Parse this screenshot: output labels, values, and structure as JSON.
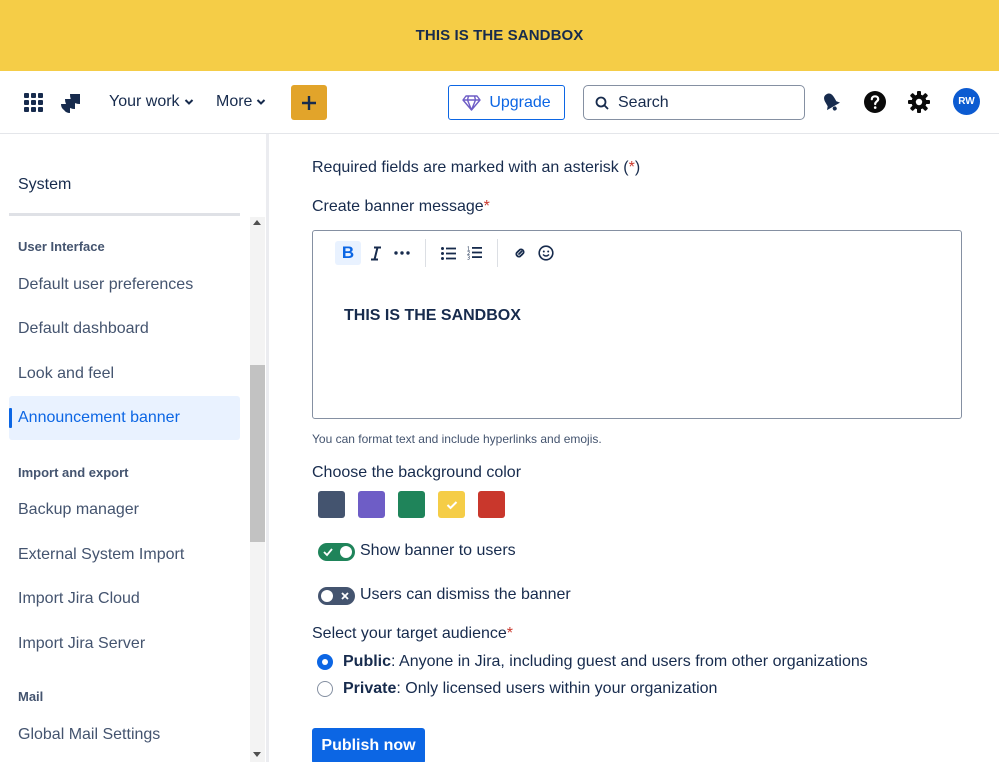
{
  "banner": {
    "text": "THIS IS THE SANDBOX",
    "color": "#f5cd47"
  },
  "topnav": {
    "your_work_label": "Your work",
    "more_label": "More",
    "create_icon": "plus-icon",
    "upgrade_label": "Upgrade",
    "search_placeholder": "Search",
    "avatar_initials": "RW",
    "accent": "#0c66e4",
    "create_color": "#e2a42a"
  },
  "sidebar": {
    "title": "System",
    "sections": [
      {
        "heading": "User Interface",
        "items": [
          "Default user preferences",
          "Default dashboard",
          "Look and feel",
          "Announcement banner"
        ]
      },
      {
        "heading": "Import and export",
        "items": [
          "Backup manager",
          "External System Import",
          "Import Jira Cloud",
          "Import Jira Server"
        ]
      },
      {
        "heading": "Mail",
        "items": [
          "Global Mail Settings"
        ]
      }
    ],
    "active_item": "Announcement banner"
  },
  "form": {
    "required_note": "Required fields are marked with an asterisk",
    "required_note_open": "(",
    "required_note_close": ")",
    "asterisk": "*",
    "message_label": "Create banner message",
    "toolbar": {
      "bold": "B",
      "icons": [
        "bold-icon",
        "italic-icon",
        "more-formatting-icon",
        "bullet-list-icon",
        "numbered-list-icon",
        "link-icon",
        "emoji-icon"
      ]
    },
    "message_value": "THIS IS THE SANDBOX",
    "helper_text": "You can format text and include hyperlinks and emojis.",
    "bg_color_label": "Choose the background color",
    "bg_colors": [
      "#44546f",
      "#6e5dc6",
      "#1f845a",
      "#f5cd47",
      "#c9372c"
    ],
    "selected_bg_color": "#f5cd47",
    "show_banner_label": "Show banner to users",
    "show_banner_on": true,
    "dismiss_label": "Users can dismiss the banner",
    "dismiss_on": false,
    "audience_label": "Select your target audience",
    "audience_options": [
      {
        "title": "Public",
        "desc": ": Anyone in Jira, including guest and users from other organizations",
        "checked": true
      },
      {
        "title": "Private",
        "desc": ": Only licensed users within your organization",
        "checked": false
      }
    ],
    "publish_label": "Publish now"
  }
}
